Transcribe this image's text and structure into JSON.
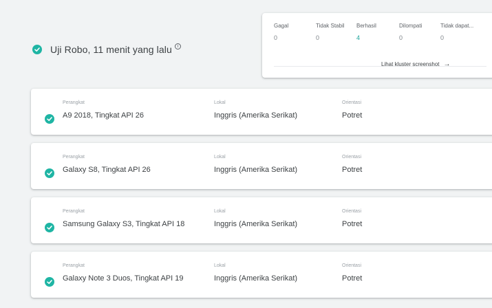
{
  "header": {
    "title": "Uji Robo, 11 menit yang lalu",
    "info_icon": "info-icon",
    "status_color": "#1fb5a4"
  },
  "stats": {
    "items": [
      {
        "label": "Gagal",
        "value": "0"
      },
      {
        "label": "Tidak Stabil",
        "value": "0"
      },
      {
        "label": "Berhasil",
        "value": "4"
      },
      {
        "label": "Dilompati",
        "value": "0"
      },
      {
        "label": "Tidak dapat...",
        "value": "0"
      }
    ],
    "cluster_link": "Lihat kluster screenshot",
    "accent_color": "#1aa39a"
  },
  "devices": [
    {
      "device_label": "Perangkat",
      "device": "A9 2018, Tingkat API 26",
      "locale_label": "Lokal",
      "locale": "Inggris (Amerika Serikat)",
      "orientation_label": "Orientasi",
      "orientation": "Potret"
    },
    {
      "device_label": "Perangkat",
      "device": "Galaxy S8, Tingkat API 26",
      "locale_label": "Lokal",
      "locale": "Inggris (Amerika Serikat)",
      "orientation_label": "Orientasi",
      "orientation": "Potret"
    },
    {
      "device_label": "Perangkat",
      "device": "Samsung Galaxy S3, Tingkat API 18",
      "locale_label": "Lokal",
      "locale": "Inggris (Amerika Serikat)",
      "orientation_label": "Orientasi",
      "orientation": "Potret"
    },
    {
      "device_label": "Perangkat",
      "device": "Galaxy Note 3 Duos, Tingkat API 19",
      "locale_label": "Lokal",
      "locale": "Inggris (Amerika Serikat)",
      "orientation_label": "Orientasi",
      "orientation": "Potret"
    }
  ]
}
